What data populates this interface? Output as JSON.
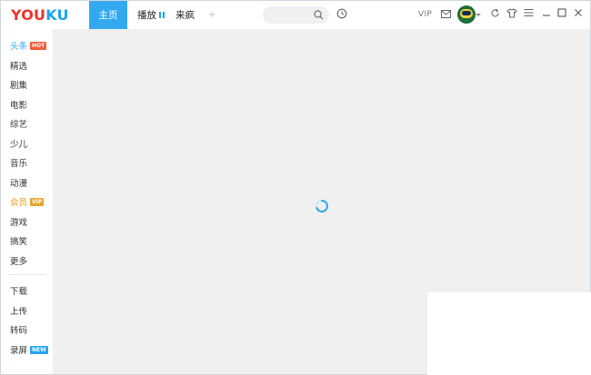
{
  "app": {
    "logo_part1": "YOU",
    "logo_part2": "KU"
  },
  "header": {
    "tabs": [
      {
        "label": "主页",
        "active": true
      },
      {
        "label": "播放",
        "active": false
      },
      {
        "label": "来疯",
        "active": false
      }
    ],
    "add_tab": "+",
    "vip_label": "VIP"
  },
  "icons": {
    "search": "search-icon",
    "history": "clock-icon",
    "mail": "mail-icon",
    "refresh": "refresh-icon",
    "skin": "shirt-icon",
    "menu": "menu-icon",
    "minimize": "minimize-icon",
    "maximize": "maximize-icon",
    "close": "close-icon",
    "loading": "loading-spinner-icon"
  },
  "sidebar": {
    "items": [
      {
        "label": "头条",
        "badge": "HOT",
        "badge_color": "#f05a3a"
      },
      {
        "label": "精选"
      },
      {
        "label": "剧集"
      },
      {
        "label": "电影"
      },
      {
        "label": "综艺"
      },
      {
        "label": "少儿"
      },
      {
        "label": "音乐"
      },
      {
        "label": "动漫"
      },
      {
        "label": "会员",
        "badge": "VIP",
        "badge_color": "#e6a530"
      },
      {
        "label": "游戏"
      },
      {
        "label": "搞笑"
      },
      {
        "label": "更多"
      }
    ],
    "tools": [
      {
        "label": "下载"
      },
      {
        "label": "上传"
      },
      {
        "label": "转码"
      },
      {
        "label": "录屏",
        "badge": "NEW",
        "badge_color": "#2aa4f0"
      }
    ]
  },
  "colors": {
    "accent": "#33aaf0",
    "logo_red": "#e8352f",
    "logo_blue": "#1aa3f0",
    "content_bg": "#f0f0f0"
  }
}
